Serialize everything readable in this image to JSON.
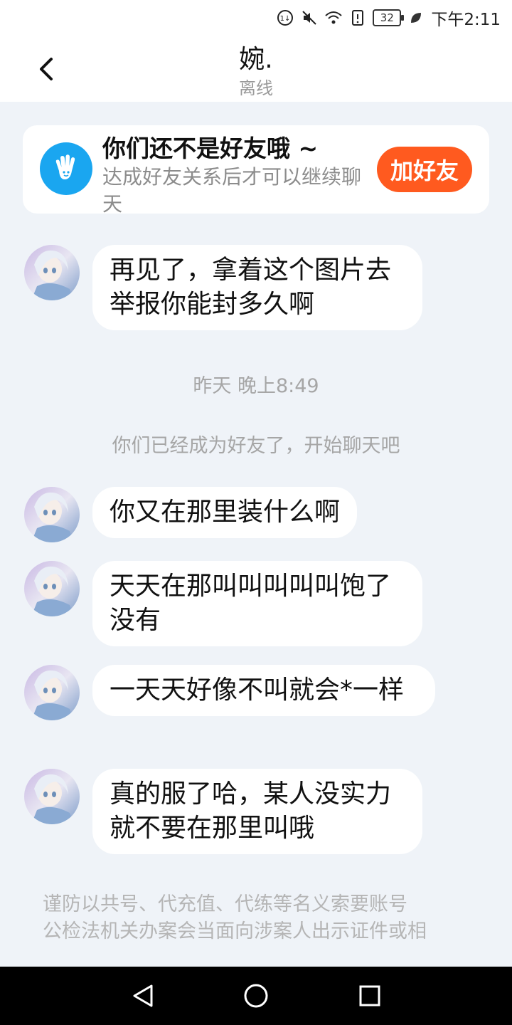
{
  "status_bar": {
    "time": "下午2:11",
    "battery": "32",
    "icons": [
      "speed-icon",
      "mute-icon",
      "wifi-icon",
      "alert-icon",
      "battery-icon",
      "leaf-icon"
    ]
  },
  "header": {
    "title": "婉.",
    "subtitle": "离线"
  },
  "friend_banner": {
    "title": "你们还不是好友哦 ~",
    "description": "达成好友关系后才可以继续聊天",
    "add_button": "加好友"
  },
  "messages": [
    {
      "text": "再见了，拿着这个图片去举报你能封多久啊"
    },
    {
      "text": "你又在那里装什么啊"
    },
    {
      "text": "天天在那叫叫叫叫叫饱了没有"
    },
    {
      "text": "一天天好像不叫就会*一样"
    },
    {
      "text": "真的服了哈，某人没实力就不要在那里叫哦"
    }
  ],
  "timestamp": "昨天 晚上8:49",
  "system_message": "你们已经成为好友了，开始聊天吧",
  "warning": {
    "line1": "谨防以共号、代充值、代练等名义索要账号",
    "line2": "公检法机关办案会当面向涉案人出示证件或相"
  },
  "colors": {
    "accent_orange": "#ff5a1f",
    "wave_blue": "#1aa6f0",
    "background": "#eff3f8"
  }
}
